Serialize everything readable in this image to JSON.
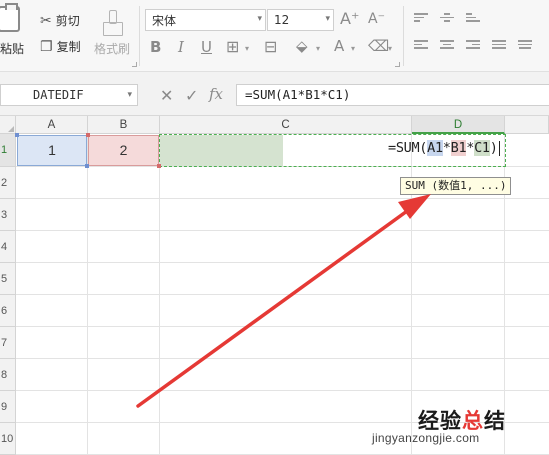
{
  "ribbon": {
    "paste_label": "粘贴",
    "cut_label": "剪切",
    "copy_label": "复制",
    "format_painter_label": "格式刷",
    "font_name": "宋体",
    "font_size": "12",
    "increase_font_glyph": "A⁺",
    "decrease_font_glyph": "A⁻",
    "bold_glyph": "B",
    "italic_glyph": "I",
    "underline_glyph": "U",
    "font_color_glyph": "A"
  },
  "formula_bar": {
    "name_box": "DATEDIF",
    "cancel_glyph": "✕",
    "confirm_glyph": "✓",
    "fx_glyph": "fx",
    "formula": "=SUM(A1*B1*C1)"
  },
  "grid": {
    "columns": [
      "A",
      "B",
      "C",
      "D"
    ],
    "rows": [
      "1",
      "2",
      "3",
      "4",
      "5",
      "6",
      "7",
      "8",
      "9",
      "10"
    ],
    "cells": {
      "A1": "1",
      "B1": "2"
    }
  },
  "edit": {
    "prefix": "=SUM(",
    "ref1": "A1",
    "op1": "*",
    "ref2": "B1",
    "op2": "*",
    "ref3": "C1",
    "suffix": ")"
  },
  "tooltip": "SUM (数值1, ...)",
  "watermark": {
    "title_part1": "经验",
    "title_part2": "总",
    "title_part3": "结",
    "url": "jingyanzongjie.com"
  },
  "colors": {
    "arrow": "#e53935",
    "ref_a1": "#c7d6ee",
    "ref_b1": "#f0cfcf",
    "ref_c1": "#cfdfc9",
    "active_header": "#43a047"
  }
}
